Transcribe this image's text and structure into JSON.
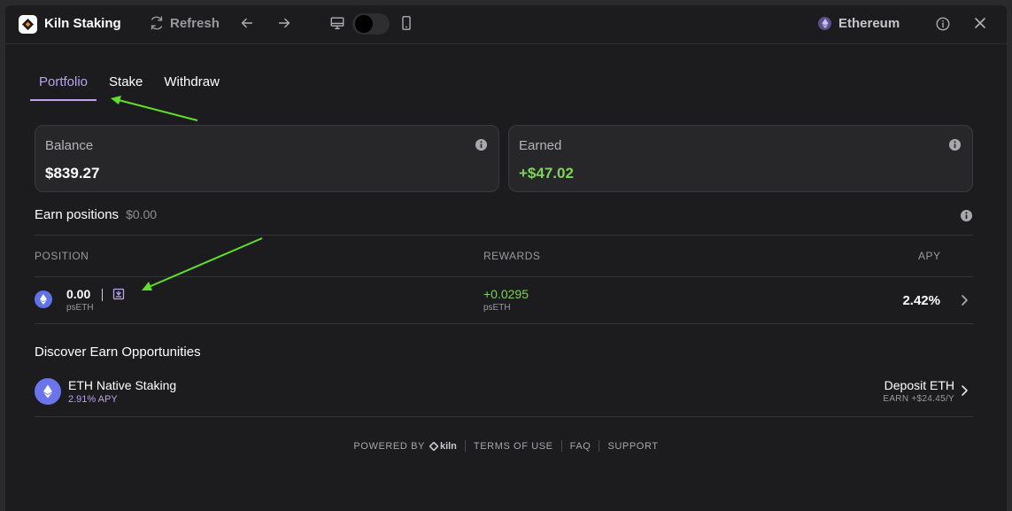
{
  "app": {
    "title": "Kiln Staking"
  },
  "toolbar": {
    "refresh_label": "Refresh",
    "network_label": "Ethereum"
  },
  "tabs": [
    {
      "label": "Portfolio",
      "active": true
    },
    {
      "label": "Stake",
      "active": false
    },
    {
      "label": "Withdraw",
      "active": false
    }
  ],
  "cards": {
    "balance": {
      "label": "Balance",
      "value": "$839.27"
    },
    "earned": {
      "label": "Earned",
      "value": "+$47.02"
    }
  },
  "earn_positions": {
    "title": "Earn positions",
    "total": "$0.00",
    "columns": {
      "position": "POSITION",
      "rewards": "REWARDS",
      "apy": "APY"
    },
    "rows": [
      {
        "amount": "0.00",
        "unit": "psETH",
        "rewards": "+0.0295",
        "rewards_unit": "psETH",
        "apy": "2.42%"
      }
    ]
  },
  "discover": {
    "title": "Discover Earn Opportunities",
    "items": [
      {
        "name": "ETH Native Staking",
        "apy": "2.91% APY",
        "cta": "Deposit ETH",
        "earn": "EARN +$24.45/Y"
      }
    ]
  },
  "footer": {
    "powered_by": "POWERED BY",
    "brand": "kiln",
    "links": [
      "TERMS OF USE",
      "FAQ",
      "SUPPORT"
    ]
  },
  "colors": {
    "accent": "#b8a4f0",
    "positive": "#7dd35b",
    "annotation_arrow": "#5ee02a"
  }
}
